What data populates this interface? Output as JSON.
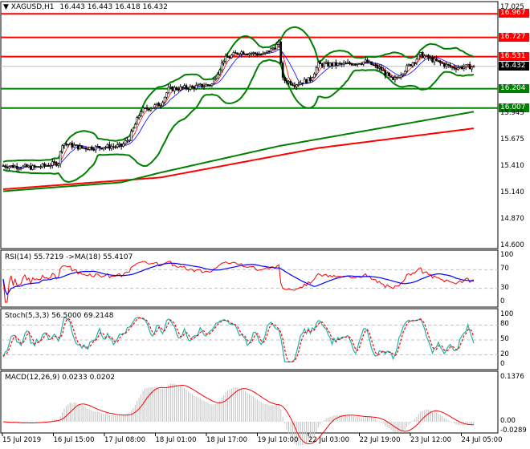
{
  "header": {
    "symbol": "XAGUSD,H1",
    "ohlc": "16.443 16.443 16.418 16.432"
  },
  "colors": {
    "resistance": "#ff0000",
    "support": "#008000",
    "bollinger": "#008000",
    "ma_slow": "#ff0000",
    "ma_mid": "#008000",
    "rsi": "#ff0000",
    "rsi_ma": "#0000ff",
    "stoch_main": "#20b2aa",
    "stoch_signal": "#ff0000",
    "macd_hist": "#c0c0c0",
    "macd_signal": "#ff0000"
  },
  "price_axis": {
    "ticks": [
      "17.025",
      "15.945",
      "15.675",
      "15.410",
      "15.140",
      "14.870",
      "14.600"
    ],
    "range": [
      14.6,
      17.025
    ]
  },
  "levels": [
    {
      "value": 16.967,
      "label": "16.967",
      "type": "resistance"
    },
    {
      "value": 16.727,
      "label": "16.727",
      "type": "resistance"
    },
    {
      "value": 16.531,
      "label": "16.531",
      "type": "resistance"
    },
    {
      "value": 16.204,
      "label": "16.204",
      "type": "support"
    },
    {
      "value": 16.007,
      "label": "16.007",
      "type": "support"
    }
  ],
  "current_price": {
    "value": 16.432,
    "label": "16.432"
  },
  "rsi": {
    "title": "RSI(14) 55.7219  ->MA(18) 55.4107",
    "ticks": [
      "100",
      "70",
      "30",
      "0"
    ]
  },
  "stoch": {
    "title": "Stoch(5,3,3) 56.5000 69.2148",
    "ticks": [
      "100",
      "80",
      "50",
      "20",
      "0"
    ]
  },
  "macd": {
    "title": "MACD(12,26,9) 0.0233 0.0202",
    "ticks": [
      "0.1376",
      "0.00",
      "-0.0289"
    ],
    "range": [
      -0.0289,
      0.1376
    ]
  },
  "time_axis": [
    "15 Jul 2019",
    "16 Jul 15:00",
    "17 Jul 08:00",
    "18 Jul 01:00",
    "18 Jul 17:00",
    "19 Jul 10:00",
    "22 Jul 03:00",
    "22 Jul 19:00",
    "23 Jul 12:00",
    "24 Jul 05:00"
  ],
  "chart_data": {
    "type": "candlestick",
    "bars": 240,
    "close_waypoints": [
      [
        0,
        15.42
      ],
      [
        16,
        15.4
      ],
      [
        28,
        15.45
      ],
      [
        30,
        15.65
      ],
      [
        40,
        15.6
      ],
      [
        60,
        15.62
      ],
      [
        64,
        15.7
      ],
      [
        70,
        15.98
      ],
      [
        80,
        16.05
      ],
      [
        84,
        16.2
      ],
      [
        96,
        16.22
      ],
      [
        106,
        16.25
      ],
      [
        112,
        16.5
      ],
      [
        120,
        16.58
      ],
      [
        132,
        16.55
      ],
      [
        140,
        16.66
      ],
      [
        142,
        16.3
      ],
      [
        148,
        16.25
      ],
      [
        156,
        16.3
      ],
      [
        160,
        16.45
      ],
      [
        172,
        16.45
      ],
      [
        184,
        16.48
      ],
      [
        192,
        16.4
      ],
      [
        198,
        16.28
      ],
      [
        204,
        16.4
      ],
      [
        212,
        16.55
      ],
      [
        220,
        16.48
      ],
      [
        228,
        16.42
      ],
      [
        239,
        16.432
      ]
    ],
    "ma_slow_waypoints": [
      [
        0,
        15.18
      ],
      [
        80,
        15.3
      ],
      [
        160,
        15.6
      ],
      [
        239,
        15.8
      ]
    ],
    "ma_mid_waypoints": [
      [
        0,
        15.16
      ],
      [
        60,
        15.25
      ],
      [
        80,
        15.35
      ],
      [
        140,
        15.62
      ],
      [
        239,
        15.97
      ]
    ]
  }
}
